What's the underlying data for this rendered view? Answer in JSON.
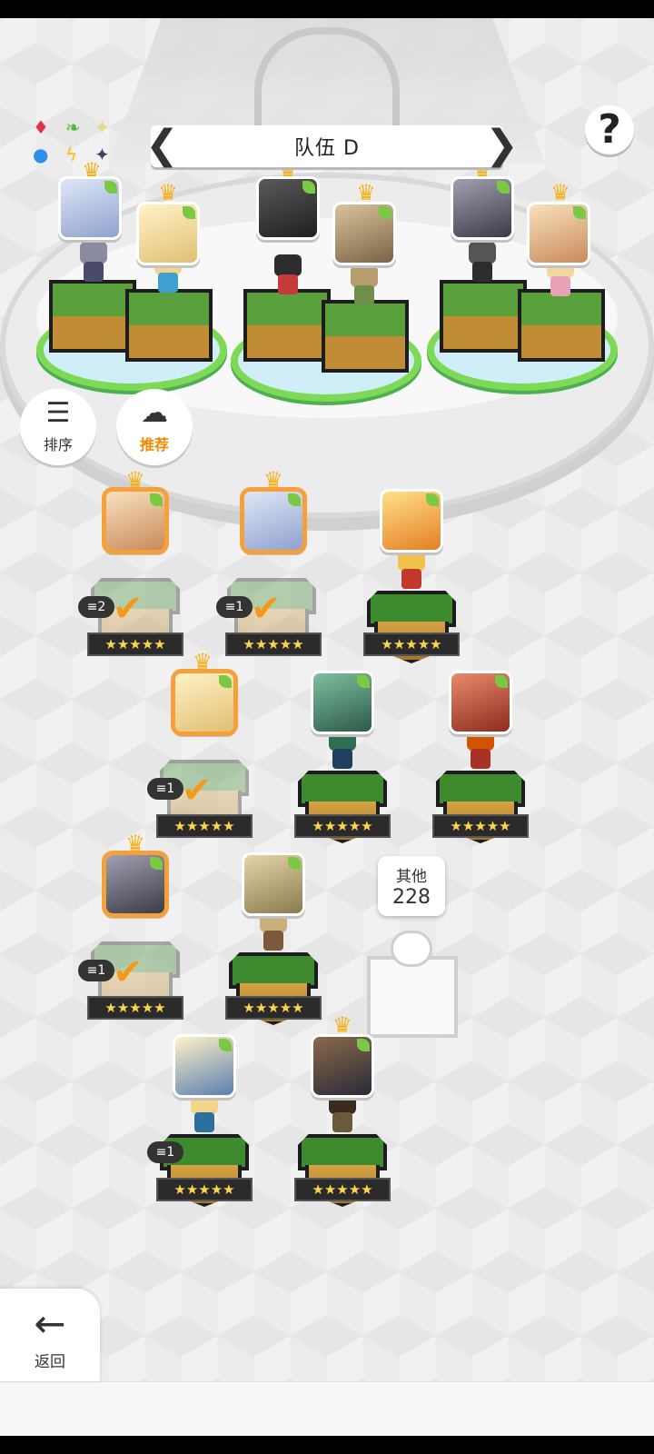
{
  "header": {
    "team_title": "队伍 D",
    "prev_arrow": "❮",
    "next_arrow": "❯",
    "help_label": "?"
  },
  "element_chart": {
    "icons": [
      "diamond-red-icon",
      "leaf-green-icon",
      "sparkle-icon",
      "circle-blue-icon",
      "bolt-yellow-icon",
      "star-dark-icon"
    ]
  },
  "side_buttons": {
    "sort_label": "排序",
    "recommend_label": "推荐"
  },
  "team_slots": [
    {
      "name": "slot-1",
      "portrait_color": "#b9c8e8",
      "leader": true
    },
    {
      "name": "slot-2",
      "portrait_color": "#f3dfa8",
      "leader": true
    },
    {
      "name": "slot-3",
      "portrait_color": "#3c3c3c",
      "leader": true
    },
    {
      "name": "slot-4",
      "portrait_color": "#a08a6a",
      "leader": true
    },
    {
      "name": "slot-5",
      "portrait_color": "#6c6c7c",
      "leader": true
    },
    {
      "name": "slot-6",
      "portrait_color": "#f1d3a6",
      "leader": true
    }
  ],
  "roster": [
    {
      "dup_count": "2",
      "stars": "★★★★★",
      "selected": true
    },
    {
      "dup_count": "1",
      "stars": "★★★★★",
      "selected": true
    },
    {
      "stars": "★★★★★",
      "selected": false
    },
    {
      "dup_count": "1",
      "stars": "★★★★★",
      "selected": true
    },
    {
      "stars": "★★★★★",
      "selected": false
    },
    {
      "stars": "★★★★★",
      "selected": false
    },
    {
      "dup_count": "1",
      "stars": "★★★★★",
      "selected": true
    },
    {
      "stars": "★★★★★",
      "selected": false
    },
    {
      "dup_count": "1",
      "stars": "★★★★★",
      "selected": false
    },
    {
      "stars": "★★★★★",
      "selected": false
    }
  ],
  "other": {
    "label": "其他",
    "count": "228"
  },
  "footer": {
    "back_label": "返回",
    "back_arrow": "←"
  },
  "colors": {
    "accent": "#f6a03c",
    "leaf": "#79c943",
    "pedestal_top": "#3d8b2e",
    "pedestal_side": "#c08c36"
  }
}
